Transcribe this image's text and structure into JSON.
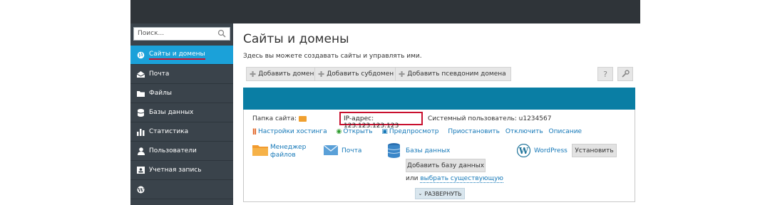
{
  "search": {
    "placeholder": "Поиск..."
  },
  "sidebar": {
    "items": [
      {
        "label": "Сайты и домены",
        "icon": "globe-icon",
        "active": true
      },
      {
        "label": "Почта",
        "icon": "mail-icon"
      },
      {
        "label": "Файлы",
        "icon": "folder-icon"
      },
      {
        "label": "Базы данных",
        "icon": "database-icon"
      },
      {
        "label": "Статистика",
        "icon": "bar-chart-icon"
      },
      {
        "label": "Пользователи",
        "icon": "user-icon"
      },
      {
        "label": "Учетная запись",
        "icon": "account-card-icon"
      },
      {
        "label": "",
        "icon": "wordpress-icon"
      }
    ]
  },
  "main": {
    "title": "Сайты и домены",
    "subtitle": "Здесь вы можете создавать сайты и управлять ими.",
    "toolbar": {
      "add_domain": "Добавить домен",
      "add_subdomain": "Добавить субдомен",
      "add_alias": "Добавить псевдоним домена"
    }
  },
  "domain_panel": {
    "site_folder_label": "Папка сайта:",
    "ip_label": "IP-адрес: 123.123.123.123",
    "system_user_label": "Системный пользователь: u1234567",
    "links": {
      "hosting_settings": "Настройки хостинга",
      "open": "Открыть",
      "preview": "Предпросмотр",
      "suspend": "Приостановить",
      "disable": "Отключить",
      "description": "Описание"
    },
    "services": {
      "file_manager": "Менеджер файлов",
      "mail": "Почта",
      "databases": "Базы данных",
      "add_database": "Добавить базу данных",
      "or_label": "или",
      "select_existing": "выбрать существующую",
      "wordpress": "WordPress",
      "install": "Установить"
    },
    "expand": "РАЗВЕРНУТЬ"
  },
  "colors": {
    "sidebar_bg": "#3a434b",
    "active_item": "#1ba1d9",
    "domain_bar": "#0a7ea4",
    "highlight_red": "#c8102e",
    "link_blue": "#1578b8"
  }
}
